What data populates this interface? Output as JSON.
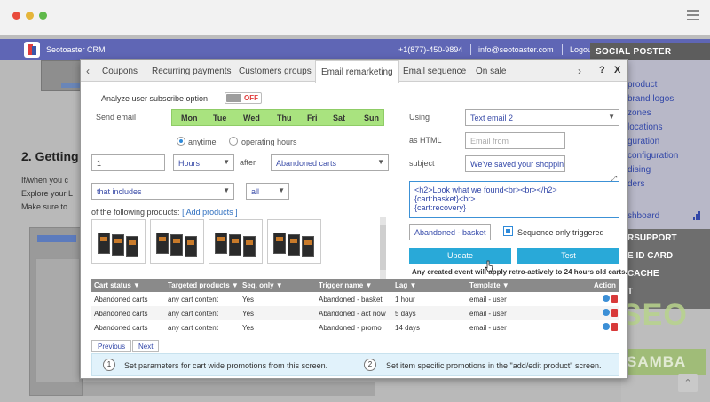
{
  "app": {
    "brand": "Seotoaster CRM",
    "phone": "+1(877)-450-9894",
    "email": "info@seotoaster.com",
    "logout": "Logou"
  },
  "background": {
    "heading": "2. Getting",
    "bullets": [
      "If/when you c",
      "Explore your L",
      "Make sure to"
    ]
  },
  "sidebar": {
    "title": "SOCIAL POSTER",
    "items": [
      "product",
      "brand logos",
      "zones",
      "locations",
      "guration",
      "configuration",
      "dising",
      "ders",
      "shboard"
    ],
    "sections": [
      "RSUPPORT",
      "E ID CARD",
      "CACHE",
      "T"
    ],
    "watermark_top": "SEO",
    "watermark_bottom": "SAMBA"
  },
  "tabs": {
    "items": [
      "Coupons",
      "Recurring payments",
      "Customers groups",
      "Email remarketing",
      "Email sequence",
      "On sale"
    ],
    "active": "Email remarketing",
    "help": "?",
    "close": "X"
  },
  "form": {
    "subscribe_label": "Analyze user subscribe option",
    "toggle_state": "OFF",
    "send_email_label": "Send email",
    "days": [
      "Mon",
      "Tue",
      "Wed",
      "Thu",
      "Fri",
      "Sat",
      "Sun"
    ],
    "radio_anytime": "anytime",
    "radio_operating": "operating hours",
    "lag_value": "1",
    "lag_unit": "Hours",
    "after_label": "after",
    "trigger": "Abandoned carts",
    "filter_mode": "that includes",
    "filter_scope": "all",
    "products_label": "of the following products:",
    "add_products": "[ Add products ]",
    "using_label": "Using",
    "template": "Text email 2",
    "as_html_label": "as HTML",
    "email_from_placeholder": "Email from",
    "subject_label": "subject",
    "subject_value": "We've saved your shoppin",
    "body_line1": "<h2>Look what we found<br><br></h2>",
    "body_line2": "{cart:basket}<br>",
    "body_line3": "{cart:recovery}",
    "trigger_name": "Abandoned - basket",
    "sequence_label": "Sequence only triggered",
    "update_button": "Update",
    "test_button": "Test",
    "note": "Any created event will apply retro-actively to 24 hours old carts."
  },
  "table": {
    "headers": [
      "Cart status",
      "Targeted products",
      "Seq. only",
      "Trigger name",
      "Lag",
      "Template",
      "Action"
    ],
    "rows": [
      [
        "Abandoned carts",
        "any cart content",
        "Yes",
        "Abandoned - basket",
        "1 hour",
        "email - user"
      ],
      [
        "Abandoned carts",
        "any cart content",
        "Yes",
        "Abandoned - act now",
        "5 days",
        "email - user"
      ],
      [
        "Abandoned carts",
        "any cart content",
        "Yes",
        "Abandoned - promo",
        "14 days",
        "email - user"
      ]
    ]
  },
  "pager": {
    "previous": "Previous",
    "next": "Next"
  },
  "help": {
    "step1_num": "1",
    "step1": "Set parameters for cart wide promotions from this screen.",
    "step2_num": "2",
    "step2": "Set item specific promotions in the \"add/edit product\" screen."
  },
  "colors": {
    "header": "#5f66b5",
    "accent": "#29a9d8",
    "days": "#a9e37f",
    "off": "#e03c3c"
  }
}
